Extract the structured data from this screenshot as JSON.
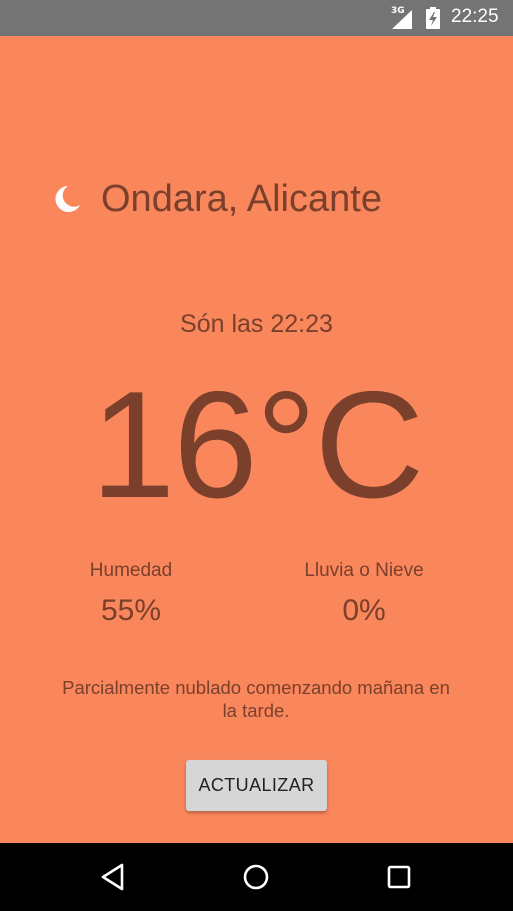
{
  "status_bar": {
    "network_label": "3G",
    "time": "22:25",
    "icons": [
      "signal-icon",
      "battery-charging-icon"
    ]
  },
  "weather": {
    "location": "Ondara, Alicante",
    "time_text": "Són las 22:23",
    "temperature": "16°C",
    "icon": "moon-icon",
    "humidity_label": "Humedad",
    "humidity_value": "55%",
    "precip_label": "Lluvia o Nieve",
    "precip_value": "0%",
    "summary": "Parcialmente nublado comenzando mañana en la tarde."
  },
  "actions": {
    "refresh_label": "ACTUALIZAR"
  },
  "nav_bar": {
    "icons": [
      "back-icon",
      "home-icon",
      "recents-icon"
    ]
  },
  "colors": {
    "background": "#fa865c",
    "text": "#7a402b",
    "status_bar": "#747474",
    "button": "#d6d6d6"
  }
}
